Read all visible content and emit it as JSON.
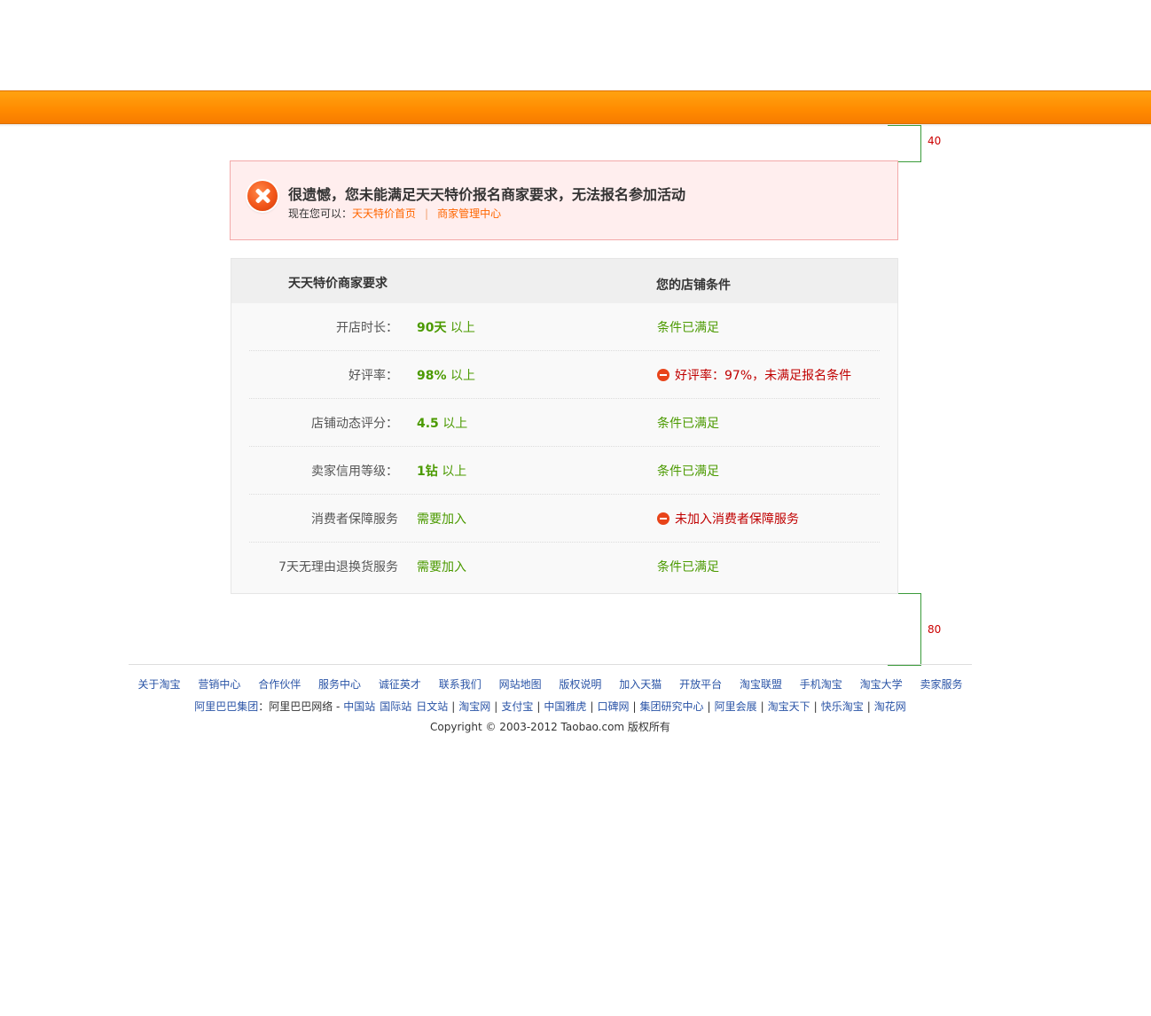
{
  "annotations": {
    "top_gap": "40",
    "bottom_gap": "80"
  },
  "error": {
    "title": "很遗憾，您未能满足天天特价报名商家要求，无法报名参加活动",
    "prompt": "现在您可以：",
    "link1": "天天特价首页",
    "separator": "|",
    "link2": "商家管理中心"
  },
  "table": {
    "header_left": "天天特价商家要求",
    "header_right": "您的店铺条件",
    "rows": [
      {
        "label": "开店时长：",
        "value_strong": "90天",
        "value_suffix": " 以上",
        "status": "条件已满足",
        "ok": true
      },
      {
        "label": "好评率：",
        "value_strong": "98%",
        "value_suffix": " 以上",
        "status": "好评率：97%，未满足报名条件",
        "ok": false
      },
      {
        "label": "店铺动态评分：",
        "value_strong": "4.5",
        "value_suffix": " 以上",
        "status": "条件已满足",
        "ok": true
      },
      {
        "label": "卖家信用等级：",
        "value_strong": "1钻",
        "value_suffix": " 以上",
        "status": "条件已满足",
        "ok": true
      },
      {
        "label": "消费者保障服务",
        "value_strong": "",
        "value_suffix": "需要加入",
        "status": "未加入消费者保障服务",
        "ok": false
      },
      {
        "label": "7天无理由退换货服务",
        "value_strong": "",
        "value_suffix": "需要加入",
        "status": "条件已满足",
        "ok": true
      }
    ]
  },
  "footer": {
    "links": [
      "关于淘宝",
      "营销中心",
      "合作伙伴",
      "服务中心",
      "诚征英才",
      "联系我们",
      "网站地图",
      "版权说明",
      "加入天猫",
      "开放平台",
      "淘宝联盟",
      "手机淘宝",
      "淘宝大学",
      "卖家服务"
    ],
    "group_label": "阿里巴巴集团",
    "group_colon": "：",
    "network_label": "阿里巴巴网络 - ",
    "network_sites": [
      "中国站",
      "国际站",
      "日文站"
    ],
    "group_sites": [
      "淘宝网",
      "支付宝",
      "中国雅虎",
      "口碑网",
      "集团研究中心",
      "阿里会展",
      "淘宝天下",
      "快乐淘宝",
      "淘花网"
    ],
    "copyright": "Copyright © 2003-2012 Taobao.com 版权所有"
  },
  "colors": {
    "accent_orange": "#ff8a00",
    "ok_green": "#4b9a00",
    "fail_red": "#c00000",
    "link_blue": "#2953a6",
    "error_bg": "#ffeeee"
  },
  "icons": {
    "error": "error-x-icon",
    "fail": "minus-circle-icon"
  }
}
